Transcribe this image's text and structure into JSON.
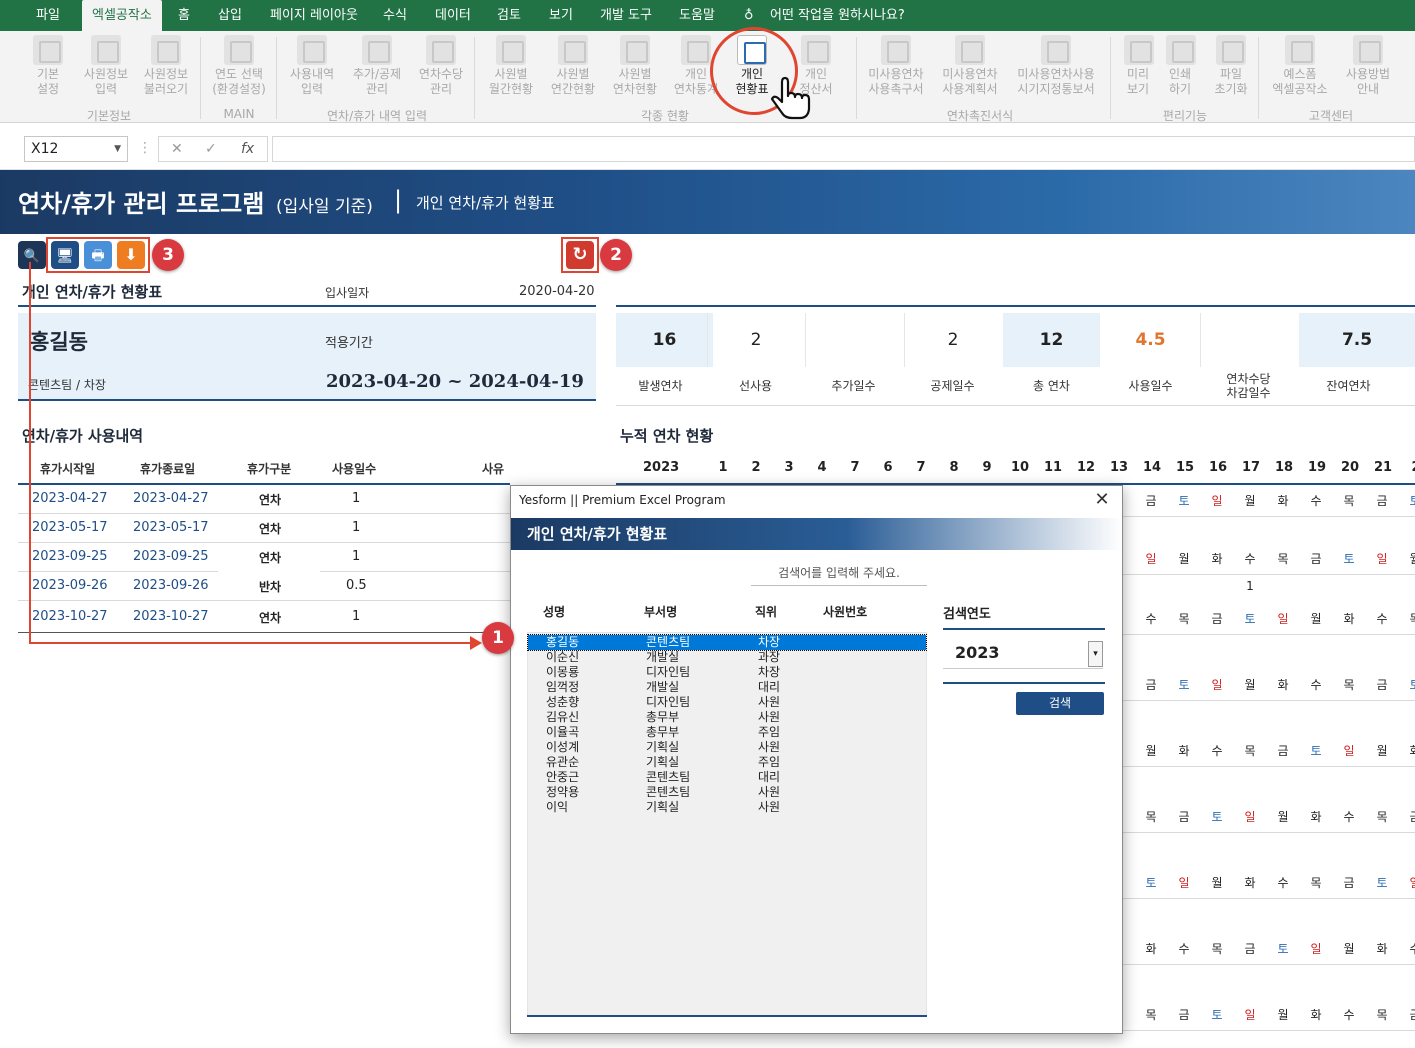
{
  "menu": {
    "tabs": [
      "파일",
      "엑셀공작소",
      "홈",
      "삽입",
      "페이지 레이아웃",
      "수식",
      "데이터",
      "검토",
      "보기",
      "개발 도구",
      "도움말"
    ],
    "tell_me": "어떤 작업을 원하시나요?"
  },
  "ribbon": {
    "buttons": [
      {
        "l1": "기본",
        "l2": "설정"
      },
      {
        "l1": "사원정보",
        "l2": "입력"
      },
      {
        "l1": "사원정보",
        "l2": "불러오기"
      },
      {
        "l1": "연도 선택",
        "l2": "(환경설정)"
      },
      {
        "l1": "사용내역",
        "l2": "입력"
      },
      {
        "l1": "추가/공제",
        "l2": "관리"
      },
      {
        "l1": "연차수당",
        "l2": "관리"
      },
      {
        "l1": "사원별",
        "l2": "월간현황"
      },
      {
        "l1": "사원별",
        "l2": "연간현황"
      },
      {
        "l1": "사원별",
        "l2": "연차현황"
      },
      {
        "l1": "개인",
        "l2": "연차통계"
      },
      {
        "l1": "개인",
        "l2": "현황표"
      },
      {
        "l1": "개인",
        "l2": "정산서"
      },
      {
        "l1": "미사용연차",
        "l2": "사용촉구서"
      },
      {
        "l1": "미사용연차",
        "l2": "사용계획서"
      },
      {
        "l1": "미사용연차사용",
        "l2": "시기지정통보서"
      },
      {
        "l1": "미리",
        "l2": "보기"
      },
      {
        "l1": "인쇄",
        "l2": "하기"
      },
      {
        "l1": "파일",
        "l2": "초기화"
      },
      {
        "l1": "예스폼",
        "l2": "엑셀공작소"
      },
      {
        "l1": "사용방법",
        "l2": "안내"
      }
    ],
    "groups": [
      "기본정보",
      "MAIN",
      "연차/휴가 내역 입력",
      "각종 현황",
      "연차촉진서식",
      "편리기능",
      "고객센터"
    ]
  },
  "formula_bar": {
    "name_box": "X12",
    "cancel": "✕",
    "enter": "✓",
    "fx": "fx",
    "formula": ""
  },
  "header": {
    "title": "연차/휴가 관리 프로그램",
    "subtitle": "(입사일 기준)",
    "sep": "|",
    "current": "개인 연차/휴가 현황표"
  },
  "toolbar": {
    "zoom": "🔍",
    "screen": "🖥",
    "print": "🖶",
    "download": "⬇",
    "refresh": "↻"
  },
  "badges": {
    "b1": "1",
    "b2": "2",
    "b3": "3"
  },
  "personal": {
    "section_title": "개인 연차/휴가 현황표",
    "hire_label": "입사일자",
    "hire_date": "2020-04-20",
    "name": "홍길동",
    "period_label": "적용기간",
    "dept_pos": "콘텐츠팀 / 차장",
    "period": "2023-04-20 ~ 2024-04-19"
  },
  "stats": [
    {
      "value": "16",
      "label": "발생연차"
    },
    {
      "value": "2",
      "label": "선사용"
    },
    {
      "value": "",
      "label": "추가일수"
    },
    {
      "value": "2",
      "label": "공제일수"
    },
    {
      "value": "12",
      "label": "총 연차"
    },
    {
      "value": "4.5",
      "label": "사용일수"
    },
    {
      "value": "",
      "label": "연차수당\n차감일수"
    },
    {
      "value": "7.5",
      "label": "잔여연차"
    }
  ],
  "usage": {
    "section_title": "연차/휴가 사용내역",
    "headers": [
      "휴가시작일",
      "휴가종료일",
      "휴가구분",
      "사용일수",
      "사유"
    ],
    "rows": [
      [
        "2023-04-27",
        "2023-04-27",
        "연차",
        "1",
        ""
      ],
      [
        "2023-05-17",
        "2023-05-17",
        "연차",
        "1",
        ""
      ],
      [
        "2023-09-25",
        "2023-09-25",
        "연차",
        "1",
        ""
      ],
      [
        "2023-09-26",
        "2023-09-26",
        "반차",
        "0.5",
        ""
      ],
      [
        "2023-10-27",
        "2023-10-27",
        "연차",
        "1",
        ""
      ]
    ]
  },
  "calendar": {
    "section_title": "누적 연차 현황",
    "year": "2023",
    "days": [
      "1",
      "2",
      "3",
      "4",
      "7",
      "6",
      "7",
      "8",
      "9",
      "10",
      "11",
      "12",
      "13",
      "14",
      "15",
      "16",
      "17",
      "18",
      "19",
      "20",
      "21",
      "2"
    ],
    "rows": [
      {
        "cells": [
          "금",
          "토",
          "일",
          "월",
          "화",
          "수",
          "목",
          "금",
          "토"
        ]
      },
      {
        "cells": [
          "일",
          "월",
          "화",
          "수",
          "목",
          "금",
          "토",
          "일",
          "월"
        ]
      },
      {
        "cells": [
          "",
          "",
          "",
          "1",
          "",
          "",
          "",
          "",
          ""
        ]
      },
      {
        "cells": [
          "수",
          "목",
          "금",
          "토",
          "일",
          "월",
          "화",
          "수",
          "목"
        ]
      },
      {
        "cells": [
          "금",
          "토",
          "일",
          "월",
          "화",
          "수",
          "목",
          "금",
          "토"
        ]
      },
      {
        "cells": [
          "월",
          "화",
          "수",
          "목",
          "금",
          "토",
          "일",
          "월",
          "화"
        ]
      },
      {
        "cells": [
          "목",
          "금",
          "토",
          "일",
          "월",
          "화",
          "수",
          "목",
          "금"
        ]
      },
      {
        "cells": [
          "토",
          "일",
          "월",
          "화",
          "수",
          "목",
          "금",
          "토",
          "일"
        ]
      },
      {
        "cells": [
          "화",
          "수",
          "목",
          "금",
          "토",
          "일",
          "월",
          "화",
          "수"
        ]
      },
      {
        "cells": [
          "목",
          "금",
          "토",
          "일",
          "월",
          "화",
          "수",
          "목",
          "금"
        ]
      }
    ]
  },
  "dialog": {
    "titlebar": "Yesform  ||  Premium Excel Program",
    "close": "✕",
    "band": "개인 연차/휴가 현황표",
    "search_placeholder": "검색어를 입력해 주세요.",
    "headers": [
      "성명",
      "부서명",
      "직위",
      "사원번호"
    ],
    "employees": [
      [
        "홍길동",
        "콘텐츠팀",
        "차장"
      ],
      [
        "이순신",
        "개발실",
        "과장"
      ],
      [
        "이몽룡",
        "디자인팀",
        "차장"
      ],
      [
        "임꺽정",
        "개발실",
        "대리"
      ],
      [
        "성춘향",
        "디자인팀",
        "사원"
      ],
      [
        "김유신",
        "총무부",
        "사원"
      ],
      [
        "이율곡",
        "총무부",
        "주임"
      ],
      [
        "이성계",
        "기획실",
        "사원"
      ],
      [
        "유관순",
        "기획실",
        "주임"
      ],
      [
        "안중근",
        "콘텐츠팀",
        "대리"
      ],
      [
        "정약용",
        "콘텐츠팀",
        "사원"
      ],
      [
        "이익",
        "기획실",
        "사원"
      ]
    ],
    "year_label": "검색연도",
    "year_value": "2023",
    "dropdown": "▾",
    "search_button": "검색"
  },
  "colors": {
    "brand_green": "#217346",
    "navy": "#1f4e86",
    "accent_red": "#d83a3f",
    "orange_value": "#e0752f"
  }
}
